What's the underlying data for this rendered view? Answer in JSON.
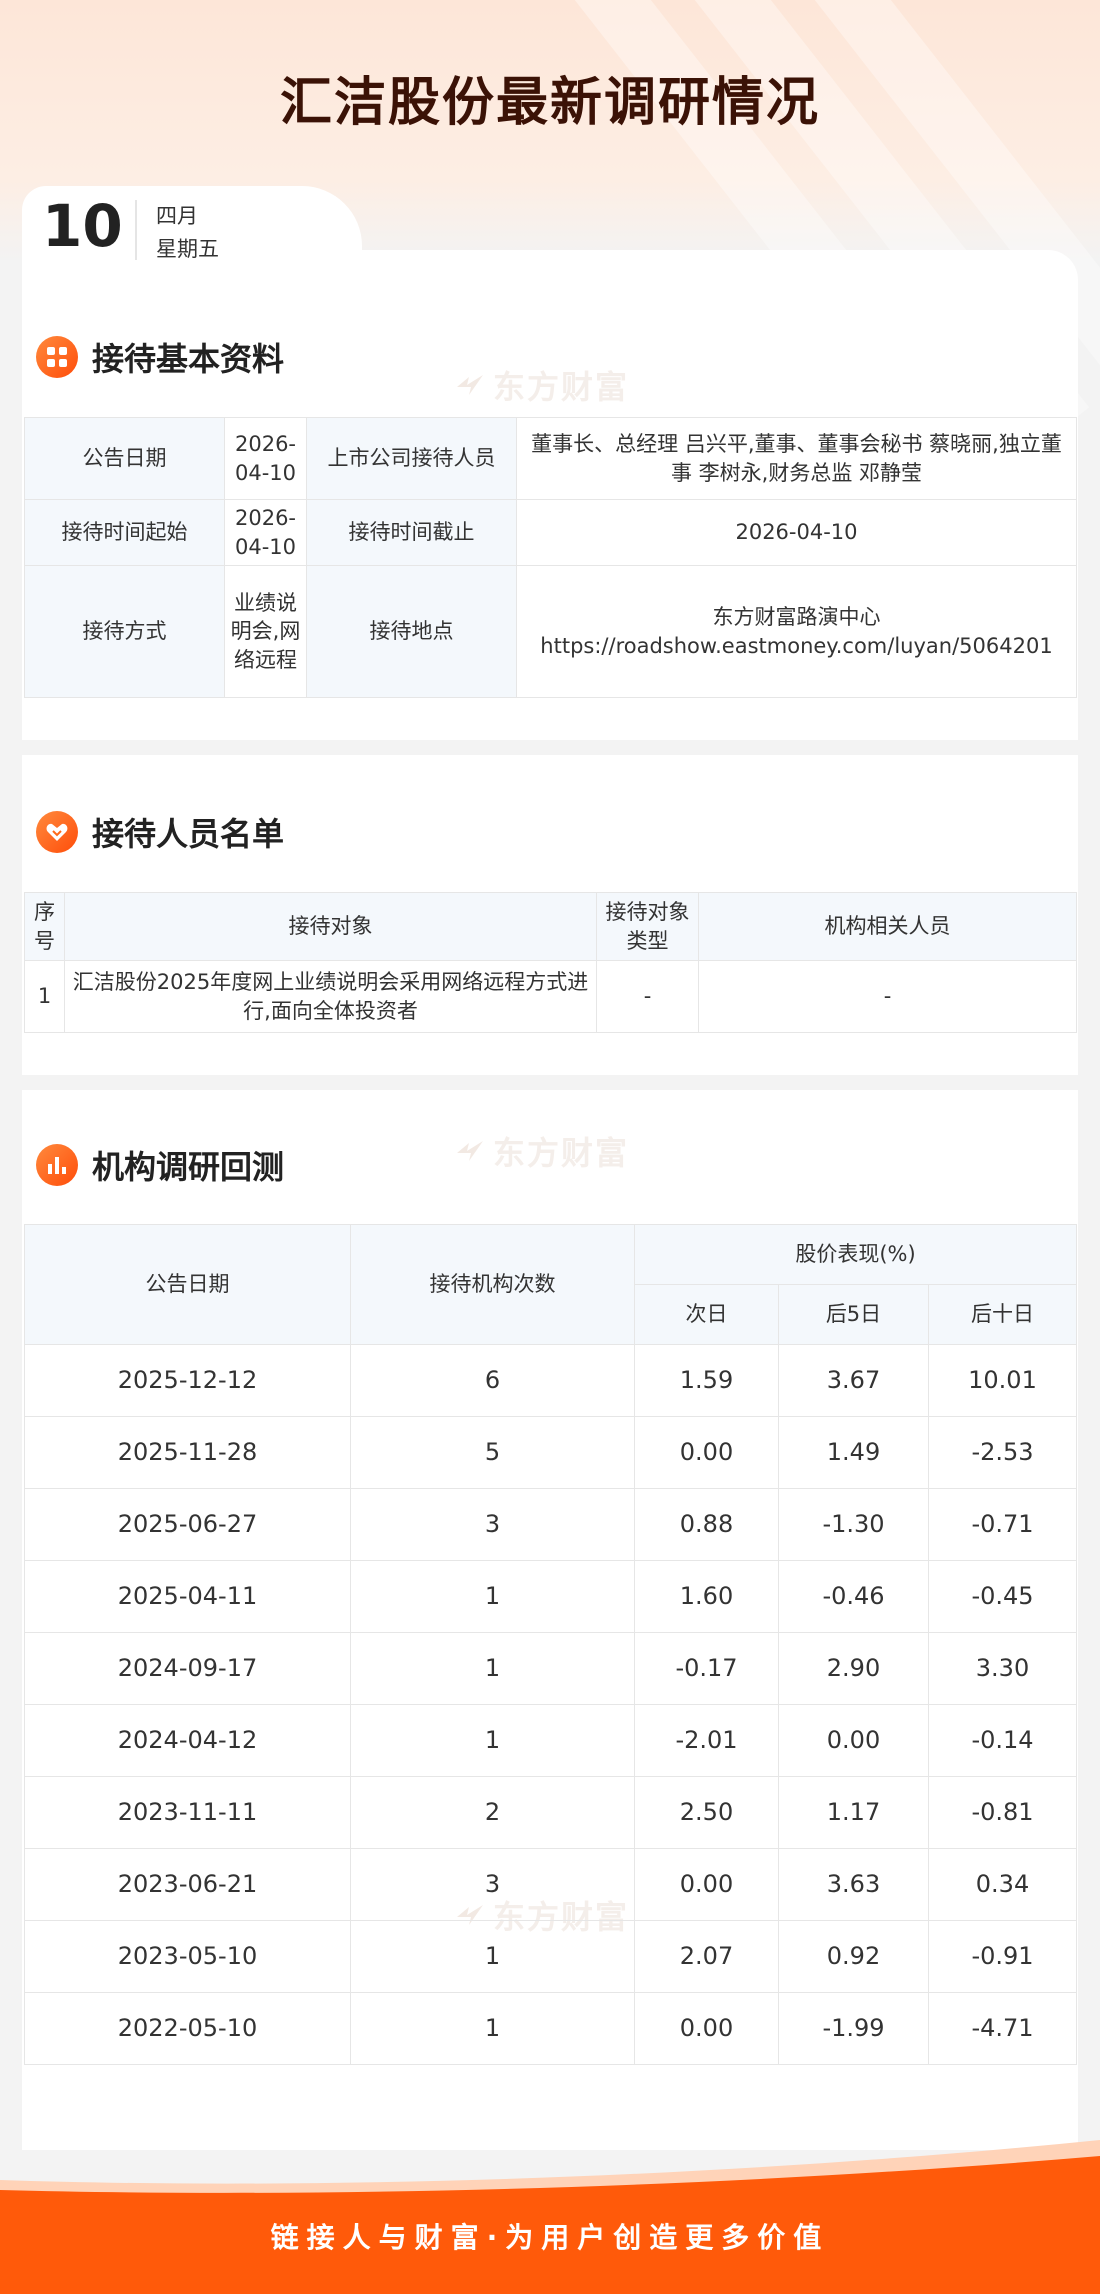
{
  "page": {
    "title": "汇洁股份最新调研情况"
  },
  "date": {
    "day": "10",
    "month": "四月",
    "weekday": "星期五"
  },
  "watermark": "东方财富",
  "sections": {
    "basic": "接待基本资料",
    "people": "接待人员名单",
    "inst": "机构调研回测"
  },
  "basic": {
    "announce_label": "公告日期",
    "announce_value": "2026-04-10",
    "staff_label": "上市公司接待人员",
    "staff_value": "董事长、总经理 吕兴平,董事、董事会秘书 蔡晓丽,独立董事 李树永,财务总监 邓静莹",
    "start_label": "接待时间起始",
    "start_value": "2026-04-10",
    "end_label": "接待时间截止",
    "end_value": "2026-04-10",
    "method_label": "接待方式",
    "method_value": "业绩说明会,网络远程",
    "place_label": "接待地点",
    "place_line1": "东方财富路演中心",
    "place_line2": "https://roadshow.eastmoney.com/luyan/5064201"
  },
  "people": {
    "headers": {
      "no": "序号",
      "target": "接待对象",
      "type": "接待对象类型",
      "staff": "机构相关人员"
    },
    "rows": [
      {
        "no": "1",
        "target": "汇洁股份2025年度网上业绩说明会采用网络远程方式进行,面向全体投资者",
        "type": "-",
        "staff": "-"
      }
    ]
  },
  "inst": {
    "headers": {
      "date": "公告日期",
      "count": "接待机构次数",
      "perf": "股价表现(%)",
      "d1": "次日",
      "d5": "后5日",
      "d10": "后十日"
    },
    "rows": [
      {
        "date": "2025-12-12",
        "count": "6",
        "d1": "1.59",
        "d5": "3.67",
        "d10": "10.01"
      },
      {
        "date": "2025-11-28",
        "count": "5",
        "d1": "0.00",
        "d5": "1.49",
        "d10": "-2.53"
      },
      {
        "date": "2025-06-27",
        "count": "3",
        "d1": "0.88",
        "d5": "-1.30",
        "d10": "-0.71"
      },
      {
        "date": "2025-04-11",
        "count": "1",
        "d1": "1.60",
        "d5": "-0.46",
        "d10": "-0.45"
      },
      {
        "date": "2024-09-17",
        "count": "1",
        "d1": "-0.17",
        "d5": "2.90",
        "d10": "3.30"
      },
      {
        "date": "2024-04-12",
        "count": "1",
        "d1": "-2.01",
        "d5": "0.00",
        "d10": "-0.14"
      },
      {
        "date": "2023-11-11",
        "count": "2",
        "d1": "2.50",
        "d5": "1.17",
        "d10": "-0.81"
      },
      {
        "date": "2023-06-21",
        "count": "3",
        "d1": "0.00",
        "d5": "3.63",
        "d10": "0.34"
      },
      {
        "date": "2023-05-10",
        "count": "1",
        "d1": "2.07",
        "d5": "0.92",
        "d10": "-0.91"
      },
      {
        "date": "2022-05-10",
        "count": "1",
        "d1": "0.00",
        "d5": "-1.99",
        "d10": "-4.71"
      }
    ]
  },
  "footer": {
    "slogan": "链接人与财富·为用户创造更多价值"
  },
  "colors": {
    "accent": "#ff5a0a",
    "title": "#3b1206",
    "label_bg": "#f4f8fc"
  }
}
